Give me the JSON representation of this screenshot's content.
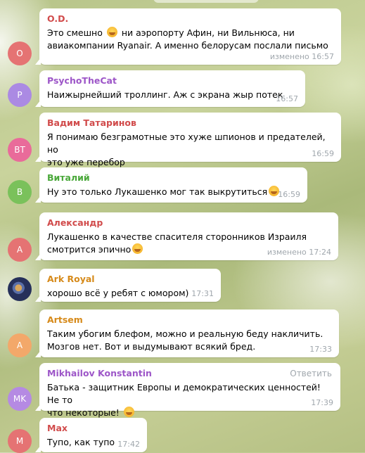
{
  "messages": [
    {
      "author": "O.D.",
      "author_color": "#d14b4b",
      "avatar_text": "O",
      "avatar_color": "#e57373",
      "line1a": "Это смешно ",
      "line1b": " ни аэропорту Афин, ни Вильнюса, ни",
      "line2": "авиакомпании Ryanair. А именно белорусам послали письмо",
      "time": "изменено 16:57"
    },
    {
      "author": "PsychoTheCat",
      "author_color": "#9d56c8",
      "avatar_text": "P",
      "avatar_color": "#ab8ae3",
      "line1": "Наижырнейший троллинг. Аж с экрана жыр потек",
      "time": "16:57"
    },
    {
      "author": "Вадим Татаринов",
      "author_color": "#d14b4b",
      "avatar_text": "ВТ",
      "avatar_color": "#e96b9a",
      "line1": "Я понимаю безграмотные это хуже шпионов и предателей, но",
      "line2": "это уже перебор",
      "time": "16:59"
    },
    {
      "author": "Виталий",
      "author_color": "#4aa83a",
      "avatar_text": "В",
      "avatar_color": "#7ac15b",
      "line1": "Ну это только Лукашенко мог так выкрутиться",
      "time": "16:59"
    },
    {
      "author": "Александр",
      "author_color": "#d14b4b",
      "avatar_text": "А",
      "avatar_color": "#e57373",
      "line1": "Лукашенко в качестве спасителя сторонников Израиля",
      "line2": "смотрится эпично",
      "time": "изменено 17:24"
    },
    {
      "author": "Ark Royal",
      "author_color": "#d68a1a",
      "avatar_text": "",
      "line1": "хорошо всё у ребят с юмором)",
      "time": "17:31"
    },
    {
      "author": "Artsem",
      "author_color": "#d68a1a",
      "avatar_text": "A",
      "avatar_color": "#f3a86a",
      "line1": "Таким убогим блефом, можно и реальную беду накличить.",
      "line2": "Мозгов нет. Вот и выдумывают всякий бред.",
      "time": "17:33"
    },
    {
      "author": "Mikhailov Konstantin",
      "author_color": "#9d56c8",
      "avatar_text": "MK",
      "avatar_color": "#b58ae3",
      "reply": "Ответить",
      "line1": "Батька - защитник Европы и демократических ценностей! Не то",
      "line2": "что некоторые! ",
      "time": "17:39"
    },
    {
      "author": "Max",
      "author_color": "#d14b4b",
      "avatar_text": "M",
      "avatar_color": "#e57373",
      "line1": "Тупо, как тупо",
      "time": "17:42"
    }
  ]
}
